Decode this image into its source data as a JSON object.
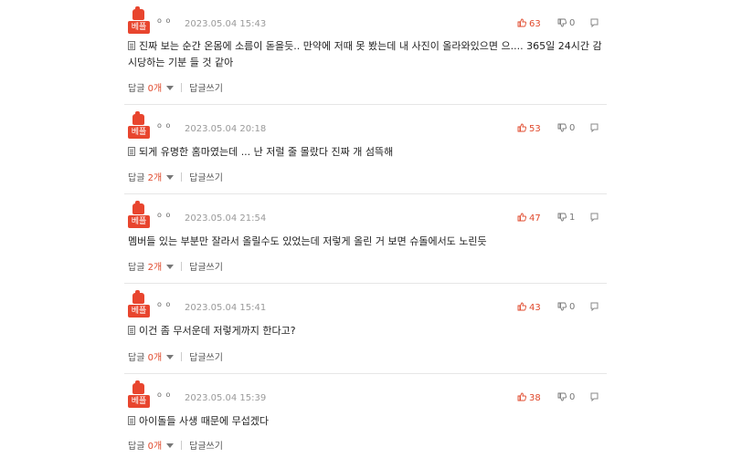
{
  "comments": [
    {
      "best_label": "베플",
      "nickname": "o o",
      "date": "2023.05.04 15:43",
      "likes": "63",
      "dislikes": "0",
      "text": "진짜 보는 순간 온몸에 소름이 돋을듯.. 만약에 저때 못 봤는데 내 사진이 올라와있으면 으.... 365일 24시간 감시당하는 기분 들 것 같아",
      "reply_label": "답글",
      "reply_count": "0개",
      "write_reply_label": "답글쓰기"
    },
    {
      "best_label": "베플",
      "nickname": "o o",
      "date": "2023.05.04 20:18",
      "likes": "53",
      "dislikes": "0",
      "text": "되게 유명한 홈마였는데 ... 난 저럴 줄 몰랐다 진짜 개 섬뜩해",
      "reply_label": "답글",
      "reply_count": "2개",
      "write_reply_label": "답글쓰기"
    },
    {
      "best_label": "베플",
      "nickname": "o o",
      "date": "2023.05.04 21:54",
      "likes": "47",
      "dislikes": "1",
      "text": "멤버들 있는 부분만 잘라서 올릴수도 있었는데 저렇게 올린 거 보면 슈돌에서도 노린듯",
      "reply_label": "답글",
      "reply_count": "2개",
      "write_reply_label": "답글쓰기"
    },
    {
      "best_label": "베플",
      "nickname": "o o",
      "date": "2023.05.04 15:41",
      "likes": "43",
      "dislikes": "0",
      "text": "이건 좀 무서운데 저렇게까지 한다고?",
      "reply_label": "답글",
      "reply_count": "0개",
      "write_reply_label": "답글쓰기"
    },
    {
      "best_label": "베플",
      "nickname": "o o",
      "date": "2023.05.04 15:39",
      "likes": "38",
      "dislikes": "0",
      "text": "아이돌들 사생 때문에 무섭겠다",
      "reply_label": "답글",
      "reply_count": "0개",
      "write_reply_label": "답글쓰기"
    }
  ],
  "icons": {
    "like": "thumbs-up-icon",
    "dislike": "thumbs-down-icon",
    "report": "report-icon",
    "text_prefix": "document-icon"
  },
  "colors": {
    "accent": "#e8452e",
    "count": "#e04a2d"
  }
}
